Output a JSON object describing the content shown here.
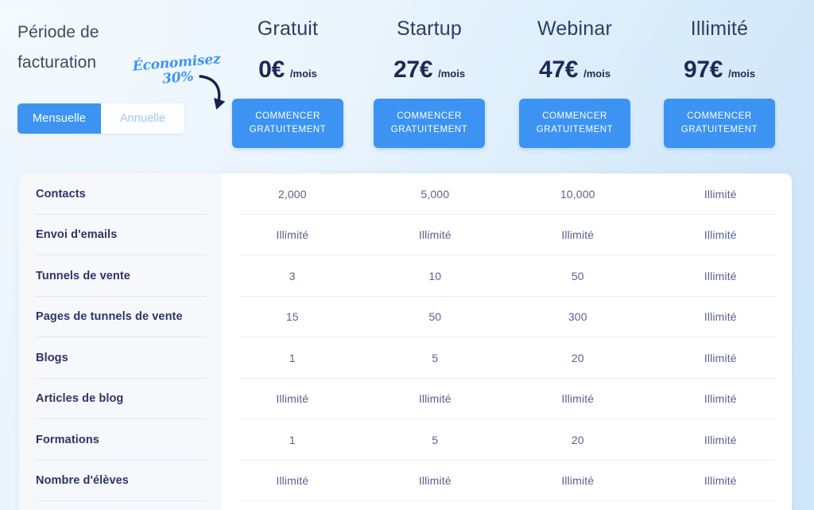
{
  "header": {
    "billing_title": "Période de\nfacturation",
    "promo_note": "Économisez\n30%",
    "promo_arrow_icon": "curved-arrow-down-left-icon",
    "toggle": {
      "monthly_label": "Mensuelle",
      "annual_label": "Annuelle",
      "selected": "Mensuelle"
    }
  },
  "plans": [
    {
      "name": "Gratuit",
      "price": "0€",
      "period": "/mois",
      "cta_line1": "COMMENCER",
      "cta_line2": "GRATUITEMENT"
    },
    {
      "name": "Startup",
      "price": "27€",
      "period": "/mois",
      "cta_line1": "COMMENCER",
      "cta_line2": "GRATUITEMENT"
    },
    {
      "name": "Webinar",
      "price": "47€",
      "period": "/mois",
      "cta_line1": "COMMENCER",
      "cta_line2": "GRATUITEMENT"
    },
    {
      "name": "Illimité",
      "price": "97€",
      "period": "/mois",
      "cta_line1": "COMMENCER",
      "cta_line2": "GRATUITEMENT"
    }
  ],
  "comparison_table": {
    "columns": [
      "Gratuit",
      "Startup",
      "Webinar",
      "Illimité"
    ],
    "rows": [
      {
        "feature": "Contacts",
        "values": [
          "2,000",
          "5,000",
          "10,000",
          "Illimité"
        ]
      },
      {
        "feature": "Envoi d'emails",
        "values": [
          "Illimité",
          "Illimité",
          "Illimité",
          "Illimité"
        ]
      },
      {
        "feature": "Tunnels de vente",
        "values": [
          "3",
          "10",
          "50",
          "Illimité"
        ]
      },
      {
        "feature": "Pages de tunnels de vente",
        "values": [
          "15",
          "50",
          "300",
          "Illimité"
        ]
      },
      {
        "feature": "Blogs",
        "values": [
          "1",
          "5",
          "20",
          "Illimité"
        ]
      },
      {
        "feature": "Articles de blog",
        "values": [
          "Illimité",
          "Illimité",
          "Illimité",
          "Illimité"
        ]
      },
      {
        "feature": "Formations",
        "values": [
          "1",
          "5",
          "20",
          "Illimité"
        ]
      },
      {
        "feature": "Nombre d'élèves",
        "values": [
          "Illimité",
          "Illimité",
          "Illimité",
          "Illimité"
        ]
      }
    ]
  },
  "colors": {
    "accent_blue": "#3d93f2",
    "title_navy": "#2c3e63",
    "price_navy": "#1d2a56",
    "label_navy": "#2b3566",
    "cell_slate": "#58618f",
    "promo_blue": "#3d95f0",
    "inactive_toggle_text": "#9ec7f3",
    "page_bg_light": "#f1f8fd",
    "page_bg_blue": "#cfe5f9",
    "card_bg": "#ffffff",
    "label_col_bg": "#f7f8fc"
  }
}
